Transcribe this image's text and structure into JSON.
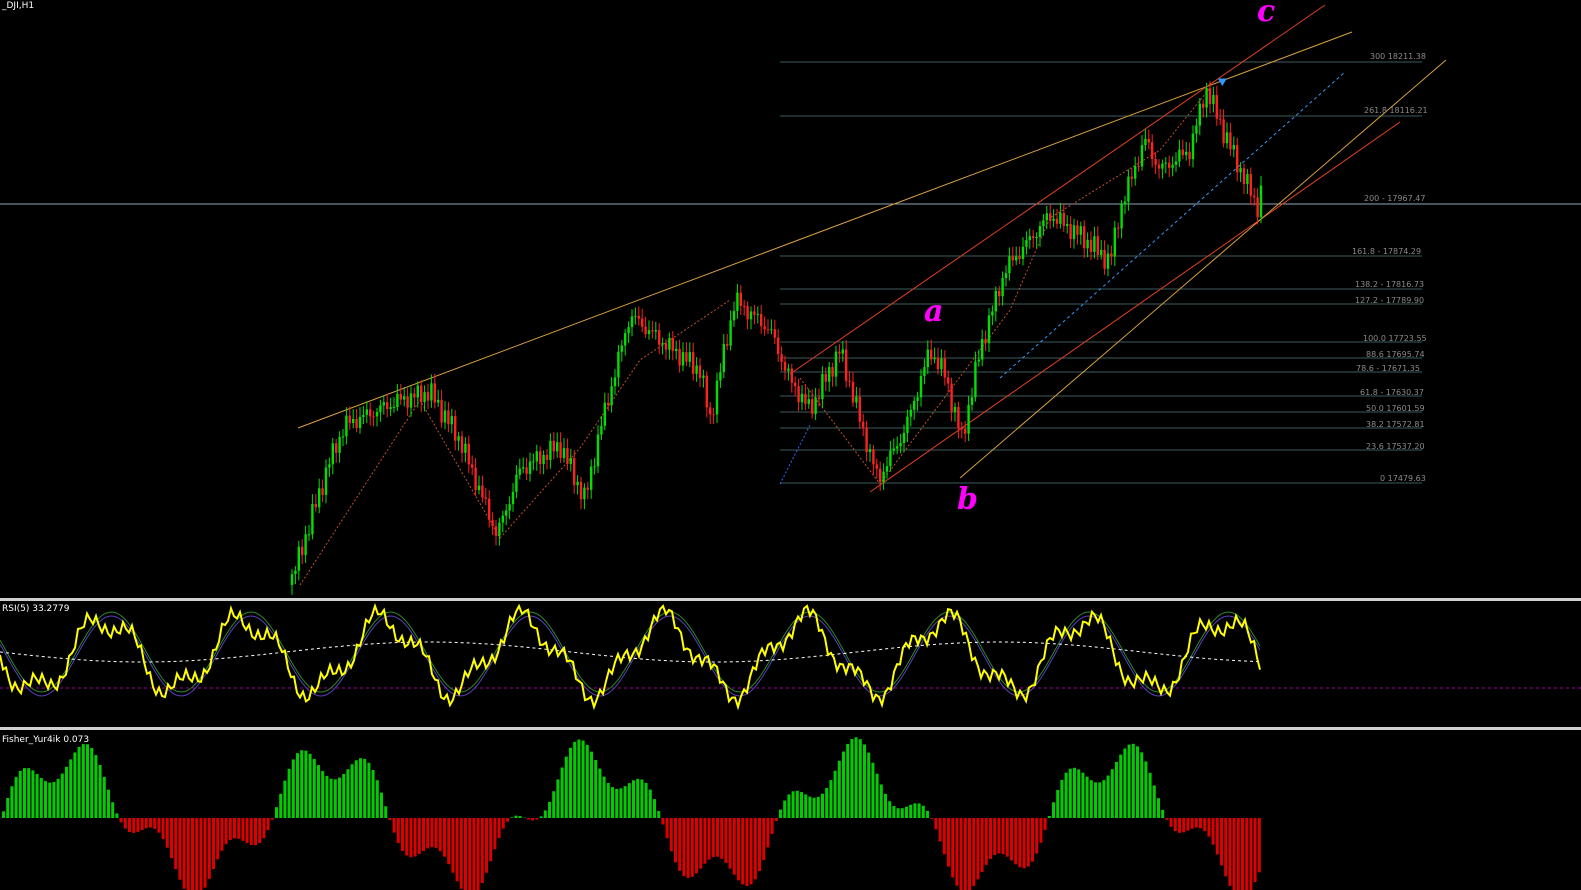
{
  "main": {
    "title": "_DJI,H1",
    "fib_levels": [
      "300 18211.38",
      "261.8 18116.21",
      "200 - 17967.47",
      "161.8 - 17874.29",
      "138.2 - 17816.73",
      "127.2 - 17789.90",
      "100.0 17723.55",
      "88.6 17695.74",
      "78.6 - 17671.35",
      "61.8 - 17630.37",
      "50.0 17601.59",
      "38.2 17572.81",
      "23.6 17537.20",
      "0 17479.63"
    ],
    "waves": {
      "a": "a",
      "b": "b",
      "c": "c"
    }
  },
  "rsi": {
    "title": "RSI(5) 33.2779"
  },
  "fisher": {
    "title": "Fisher_Yur4ik 0.073"
  },
  "colors": {
    "background": "#000000",
    "bull": "#00e000",
    "bear": "#ff2020",
    "wave_labels": "#ff00ff",
    "rsi_line": "#ffff00",
    "fisher_positive": "#00cc00",
    "fisher_negative": "#dd0000"
  }
}
